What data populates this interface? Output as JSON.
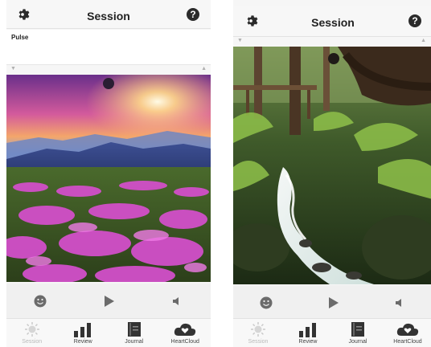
{
  "screens": [
    {
      "title": "Session",
      "pulse_label": "Pulse",
      "photo_subject": "mountain sunset with pink flowers",
      "tabs": [
        {
          "label": "Session",
          "icon": "sun-icon"
        },
        {
          "label": "Review",
          "icon": "bar-chart-icon"
        },
        {
          "label": "Journal",
          "icon": "journal-icon"
        },
        {
          "label": "HeartCloud",
          "icon": "heart-cloud-icon"
        }
      ]
    },
    {
      "title": "Session",
      "photo_subject": "forest waterfall",
      "tabs": [
        {
          "label": "Session",
          "icon": "sun-icon"
        },
        {
          "label": "Review",
          "icon": "bar-chart-icon"
        },
        {
          "label": "Journal",
          "icon": "journal-icon"
        },
        {
          "label": "HeartCloud",
          "icon": "heart-cloud-icon"
        }
      ]
    }
  ],
  "colors": {
    "header_bg": "#f7f7f7",
    "controls_bg": "#f0f0f0",
    "tab_active": "#b9b9b9",
    "icon_dark": "#2b2b2b"
  }
}
